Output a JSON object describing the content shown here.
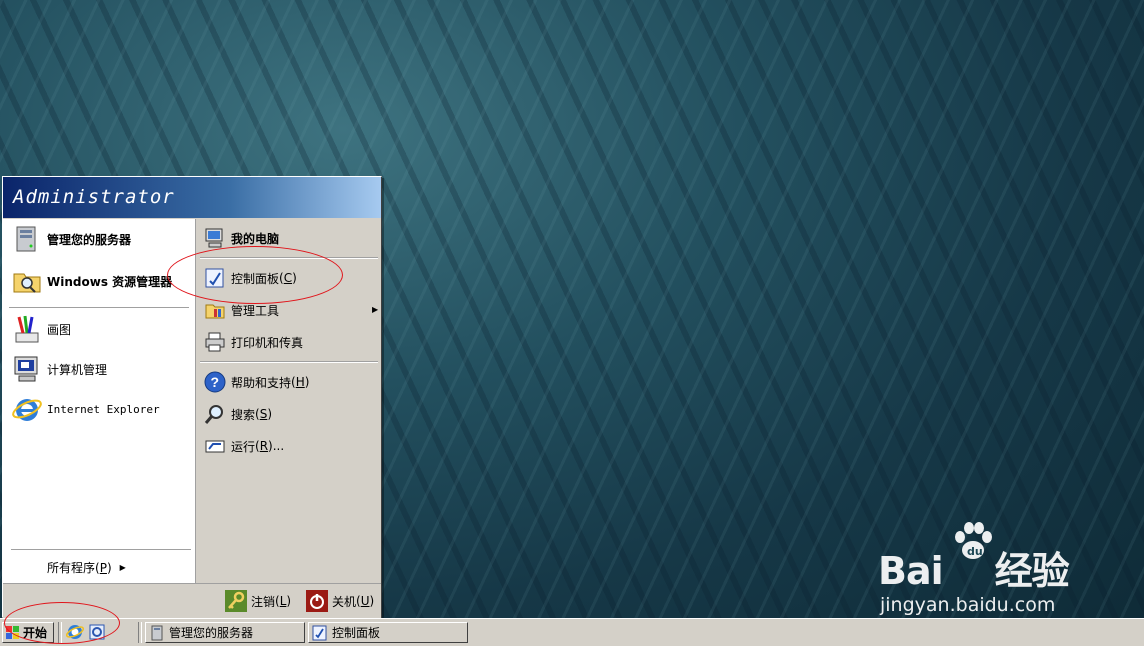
{
  "desktop": {
    "wallpaper": "grass-underwater"
  },
  "watermark": {
    "logo_text": "Bai",
    "logo_suffix": "经验",
    "url": "jingyan.baidu.com"
  },
  "start_menu": {
    "user_name": "Administrator",
    "left_items": [
      {
        "label": "管理您的服务器",
        "icon": "server-icon",
        "bold": true
      },
      {
        "label": "Windows 资源管理器",
        "icon": "folder-search-icon",
        "bold": true
      },
      {
        "label": "画图",
        "icon": "paint-icon",
        "bold": false
      },
      {
        "label": "计算机管理",
        "icon": "computer-management-icon",
        "bold": false
      },
      {
        "label": "Internet Explorer",
        "icon": "ie-icon",
        "bold": false
      }
    ],
    "all_programs": {
      "label": "所有程序",
      "hotkey": "P"
    },
    "right_items": [
      {
        "label": "我的电脑",
        "icon": "my-computer-icon"
      },
      {
        "label": "控制面板",
        "hotkey": "C",
        "icon": "control-panel-icon"
      },
      {
        "label": "管理工具",
        "icon": "admin-tools-icon"
      },
      {
        "label": "打印机和传真",
        "icon": "printer-icon"
      },
      {
        "label": "帮助和支持",
        "hotkey": "H",
        "icon": "help-icon"
      },
      {
        "label": "搜索",
        "hotkey": "S",
        "icon": "search-icon"
      },
      {
        "label": "运行",
        "hotkey": "R",
        "suffix": "...",
        "icon": "run-icon"
      }
    ],
    "logoff": {
      "label": "注销",
      "hotkey": "L"
    },
    "shutdown": {
      "label": "关机",
      "hotkey": "U"
    }
  },
  "taskbar": {
    "start_label": "开始",
    "tasks": [
      {
        "label": "管理您的服务器"
      },
      {
        "label": "控制面板"
      }
    ]
  },
  "colors": {
    "annotation": "#e0151b",
    "menu_header": "#0a246a",
    "menu_bg": "#d4d0c8"
  }
}
